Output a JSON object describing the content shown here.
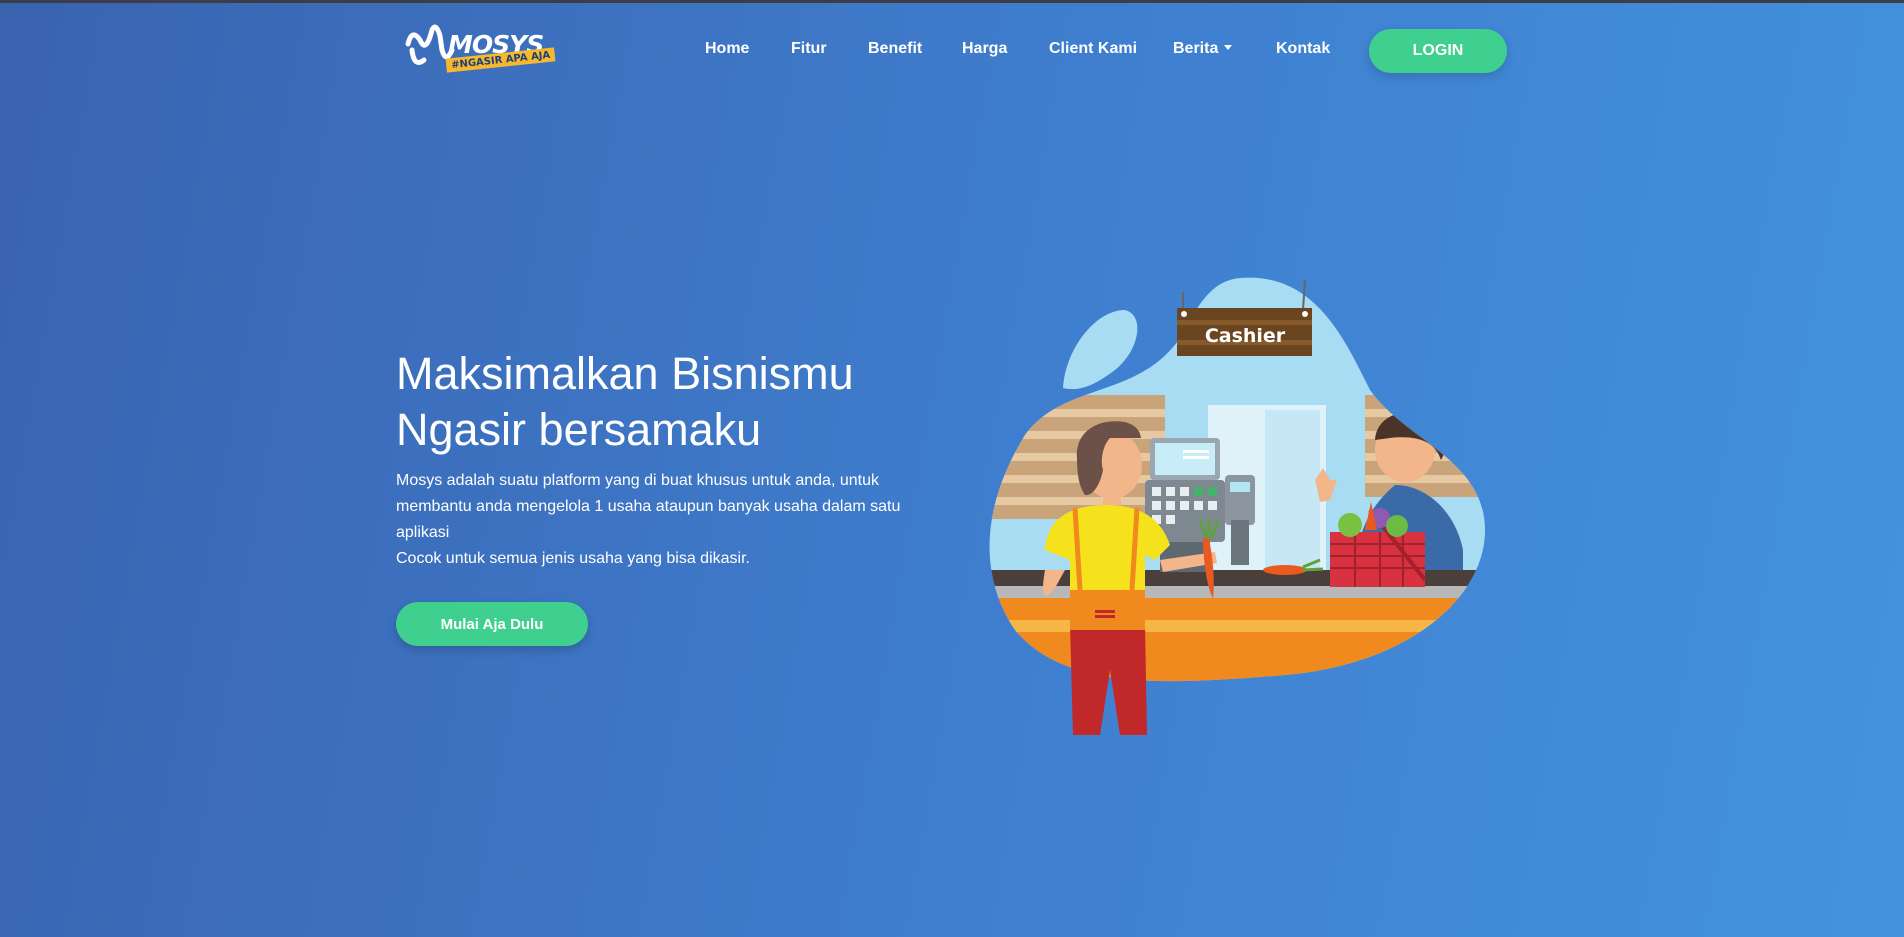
{
  "brand": {
    "name": "MOSYS",
    "tagline": "#NGASIR APA AJA"
  },
  "nav": {
    "items": [
      {
        "label": "Home"
      },
      {
        "label": "Fitur"
      },
      {
        "label": "Benefit"
      },
      {
        "label": "Harga"
      },
      {
        "label": "Client Kami"
      },
      {
        "label": "Berita"
      },
      {
        "label": "Kontak"
      }
    ],
    "login_label": "LOGIN"
  },
  "hero": {
    "title_line1": "Maksimalkan Bisnismu",
    "title_line2": "Ngasir bersamaku",
    "desc_line1": "Mosys adalah suatu platform yang di buat khusus untuk anda, untuk membantu anda mengelola 1 usaha ataupun banyak usaha dalam satu aplikasi",
    "desc_line2": "Cocok untuk semua jenis usaha yang bisa dikasir.",
    "cta_label": "Mulai Aja Dulu"
  },
  "illustration": {
    "sign_text": "Cashier"
  },
  "colors": {
    "accent_green": "#3fcf8e",
    "bg_start": "#3a63b0",
    "bg_end": "#4393de",
    "logo_tag": "#f5b82e"
  }
}
